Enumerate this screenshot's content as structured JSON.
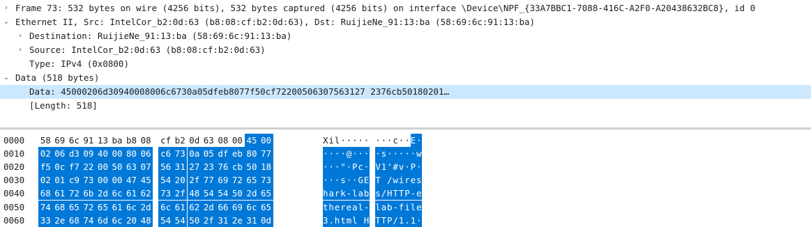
{
  "tree": {
    "rows": [
      {
        "label": "Frame 73: 532 bytes on wire (4256 bits), 532 bytes captured (4256 bits) on interface \\Device\\NPF_{33A7BBC1-7088-416C-A2F0-A20438632BC8}, id 0",
        "arrow": "›",
        "selected": false
      },
      {
        "label": "Ethernet II, Src: IntelCor_b2:0d:63 (b8:08:cf:b2:0d:63), Dst: RuijieNe_91:13:ba (58:69:6c:91:13:ba)",
        "arrow": "⌄",
        "selected": false
      },
      {
        "label": "Destination: RuijieNe_91:13:ba (58:69:6c:91:13:ba)",
        "arrow": "›",
        "selected": false
      },
      {
        "label": "Source: IntelCor_b2:0d:63 (b8:08:cf:b2:0d:63)",
        "arrow": "›",
        "selected": false
      },
      {
        "label": "Type: IPv4 (0x0800)",
        "arrow": "",
        "selected": false
      },
      {
        "label": "Data (518 bytes)",
        "arrow": "⌄",
        "selected": false
      },
      {
        "label": "Data: 45000206d30940008006c6730a05dfeb8077f50cf72200506307563127 2376cb50180201…",
        "arrow": "",
        "selected": true
      },
      {
        "label": "[Length: 518]",
        "arrow": "",
        "selected": false
      }
    ]
  },
  "hex": {
    "rows": [
      {
        "offset": "0000",
        "bytes": [
          "58",
          "69",
          "6c",
          "91",
          "13",
          "ba",
          "b8",
          "08",
          "cf",
          "b2",
          "0d",
          "63",
          "08",
          "00",
          "45",
          "00"
        ],
        "ascii": "Xil·····  ···c··E·"
      },
      {
        "offset": "0010",
        "bytes": [
          "02",
          "06",
          "d3",
          "09",
          "40",
          "00",
          "80",
          "06",
          "c6",
          "73",
          "0a",
          "05",
          "df",
          "eb",
          "80",
          "77"
        ],
        "ascii": "····@···  ·s·····w"
      },
      {
        "offset": "0020",
        "bytes": [
          "f5",
          "0c",
          "f7",
          "22",
          "00",
          "50",
          "63",
          "07",
          "56",
          "31",
          "27",
          "23",
          "76",
          "cb",
          "50",
          "18"
        ],
        "ascii": "···\"·Pc·  V1'#v·P·"
      },
      {
        "offset": "0030",
        "bytes": [
          "02",
          "01",
          "c9",
          "73",
          "00",
          "00",
          "47",
          "45",
          "54",
          "20",
          "2f",
          "77",
          "69",
          "72",
          "65",
          "73"
        ],
        "ascii": "···s··GE  T /wires"
      },
      {
        "offset": "0040",
        "bytes": [
          "68",
          "61",
          "72",
          "6b",
          "2d",
          "6c",
          "61",
          "62",
          "73",
          "2f",
          "48",
          "54",
          "54",
          "50",
          "2d",
          "65"
        ],
        "ascii": "hark-lab  s/HTTP-e"
      },
      {
        "offset": "0050",
        "bytes": [
          "74",
          "68",
          "65",
          "72",
          "65",
          "61",
          "6c",
          "2d",
          "6c",
          "61",
          "62",
          "2d",
          "66",
          "69",
          "6c",
          "65"
        ],
        "ascii": "thereal-  lab-file"
      },
      {
        "offset": "0060",
        "bytes": [
          "33",
          "2e",
          "68",
          "74",
          "6d",
          "6c",
          "20",
          "48",
          "54",
          "54",
          "50",
          "2f",
          "31",
          "2e",
          "31",
          "0d"
        ],
        "ascii": "3.html H  TTP/1.1·"
      }
    ],
    "selection_start_byte": 14
  },
  "colors": {
    "selection": "#0078d7",
    "tree_selected": "#cce8ff"
  }
}
